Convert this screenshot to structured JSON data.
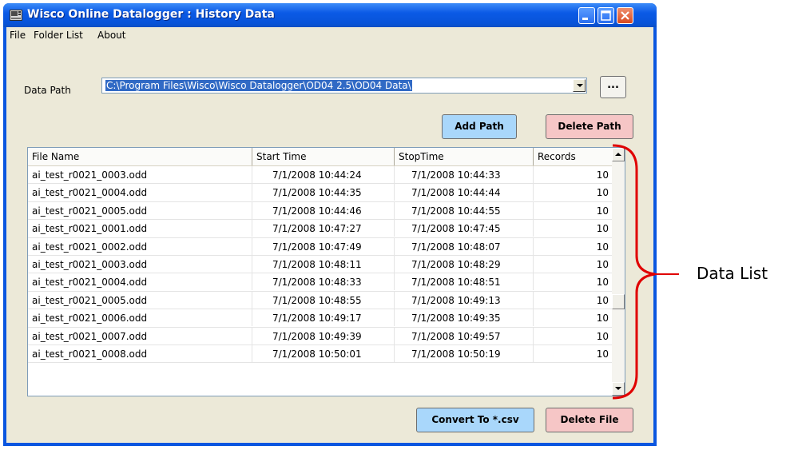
{
  "window": {
    "title": "Wisco Online Datalogger : History Data"
  },
  "menu": [
    "File",
    "Folder List",
    "About"
  ],
  "data_path": {
    "label": "Data Path",
    "value": "C:\\Program Files\\Wisco\\Wisco Datalogger\\OD04 2.5\\OD04 Data\\",
    "browse_label": "..."
  },
  "buttons": {
    "add_path": "Add Path",
    "delete_path": "Delete Path",
    "convert": "Convert To *.csv",
    "delete_file": "Delete File"
  },
  "table": {
    "columns": [
      "File Name",
      "Start Time",
      "StopTime",
      "Records"
    ],
    "rows": [
      [
        "ai_test_r0021_0003.odd",
        "7/1/2008  10:44:24",
        "7/1/2008  10:44:33",
        "10"
      ],
      [
        "ai_test_r0021_0004.odd",
        "7/1/2008  10:44:35",
        "7/1/2008  10:44:44",
        "10"
      ],
      [
        "ai_test_r0021_0005.odd",
        "7/1/2008  10:44:46",
        "7/1/2008  10:44:55",
        "10"
      ],
      [
        "ai_test_r0021_0001.odd",
        "7/1/2008  10:47:27",
        "7/1/2008  10:47:45",
        "10"
      ],
      [
        "ai_test_r0021_0002.odd",
        "7/1/2008  10:47:49",
        "7/1/2008  10:48:07",
        "10"
      ],
      [
        "ai_test_r0021_0003.odd",
        "7/1/2008  10:48:11",
        "7/1/2008  10:48:29",
        "10"
      ],
      [
        "ai_test_r0021_0004.odd",
        "7/1/2008  10:48:33",
        "7/1/2008  10:48:51",
        "10"
      ],
      [
        "ai_test_r0021_0005.odd",
        "7/1/2008  10:48:55",
        "7/1/2008  10:49:13",
        "10"
      ],
      [
        "ai_test_r0021_0006.odd",
        "7/1/2008  10:49:17",
        "7/1/2008  10:49:35",
        "10"
      ],
      [
        "ai_test_r0021_0007.odd",
        "7/1/2008  10:49:39",
        "7/1/2008  10:49:57",
        "10"
      ],
      [
        "ai_test_r0021_0008.odd",
        "7/1/2008  10:50:01",
        "7/1/2008  10:50:19",
        "10"
      ]
    ]
  },
  "annotation": {
    "label": "Data List",
    "color": "#e00000"
  },
  "colors": {
    "titlebar": "#0b5ae6",
    "add_path_btn": "#a9d7fb",
    "delete_btn": "#f6c6c6",
    "selection": "#316ac5"
  }
}
